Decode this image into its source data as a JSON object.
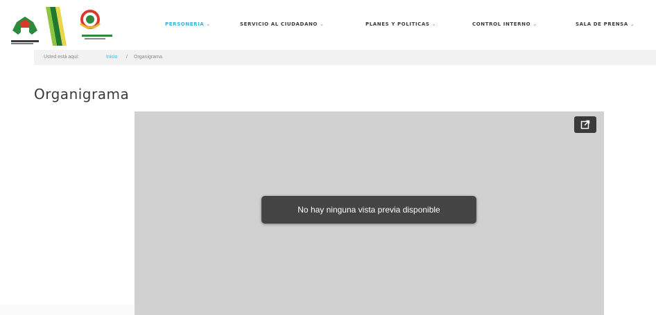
{
  "nav": {
    "items": [
      {
        "label": "PERSONERIA",
        "chevron": "⌄",
        "active": true
      },
      {
        "label": "SERVICIO AL CIUDADANO",
        "chevron": "⌄",
        "active": false
      },
      {
        "label": "PLANES Y POLITICAS",
        "chevron": "⌄",
        "active": false
      },
      {
        "label": "CONTROL INTERNO",
        "chevron": "⌄",
        "active": false
      },
      {
        "label": "SALA DE PRENSA",
        "chevron": "⌄",
        "active": false
      }
    ]
  },
  "breadcrumb": {
    "prefix": "Usted está aquí:",
    "home": "Inicio",
    "separator": "/",
    "current": "Organigrama"
  },
  "page": {
    "title": "Organigrama"
  },
  "viewer": {
    "message": "No hay ninguna vista previa disponible",
    "popout_icon": "open-in-new-window-icon"
  },
  "colors": {
    "accent": "#35b4d6",
    "viewer_bg": "#d1d1d1",
    "toast_bg": "#444444"
  }
}
